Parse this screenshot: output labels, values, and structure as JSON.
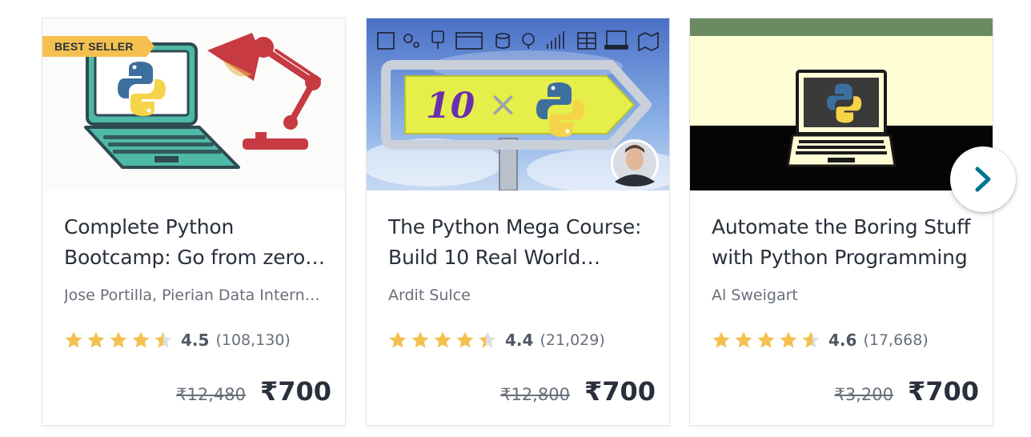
{
  "courses": [
    {
      "badge": "BEST SELLER",
      "title_line1": "Complete Python",
      "title_line2": "Bootcamp: Go from zero…",
      "author": "Jose Portilla, Pierian Data Intern…",
      "rating": "4.5",
      "rating_fraction": 0.9,
      "reviews": "(108,130)",
      "original_price": "₹12,480",
      "price": "₹700"
    },
    {
      "title_line1": "The Python Mega Course:",
      "title_line2": "Build 10 Real World…",
      "author": "Ardit Sulce",
      "rating": "4.4",
      "rating_fraction": 0.88,
      "reviews": "(21,029)",
      "original_price": "₹12,800",
      "price": "₹700",
      "thumb_sign_text": "10",
      "thumb_sign_symbol": "×"
    },
    {
      "title_line1": "Automate the Boring Stuff",
      "title_line2": "with Python Programming",
      "author": "Al Sweigart",
      "rating": "4.6",
      "rating_fraction": 0.92,
      "reviews": "(17,668)",
      "original_price": "₹3,200",
      "price": "₹700"
    }
  ],
  "carousel": {
    "next_icon": "chevron-right-icon"
  },
  "colors": {
    "star": "#f4c150",
    "badge": "#f4c150",
    "next_arrow": "#007791"
  }
}
